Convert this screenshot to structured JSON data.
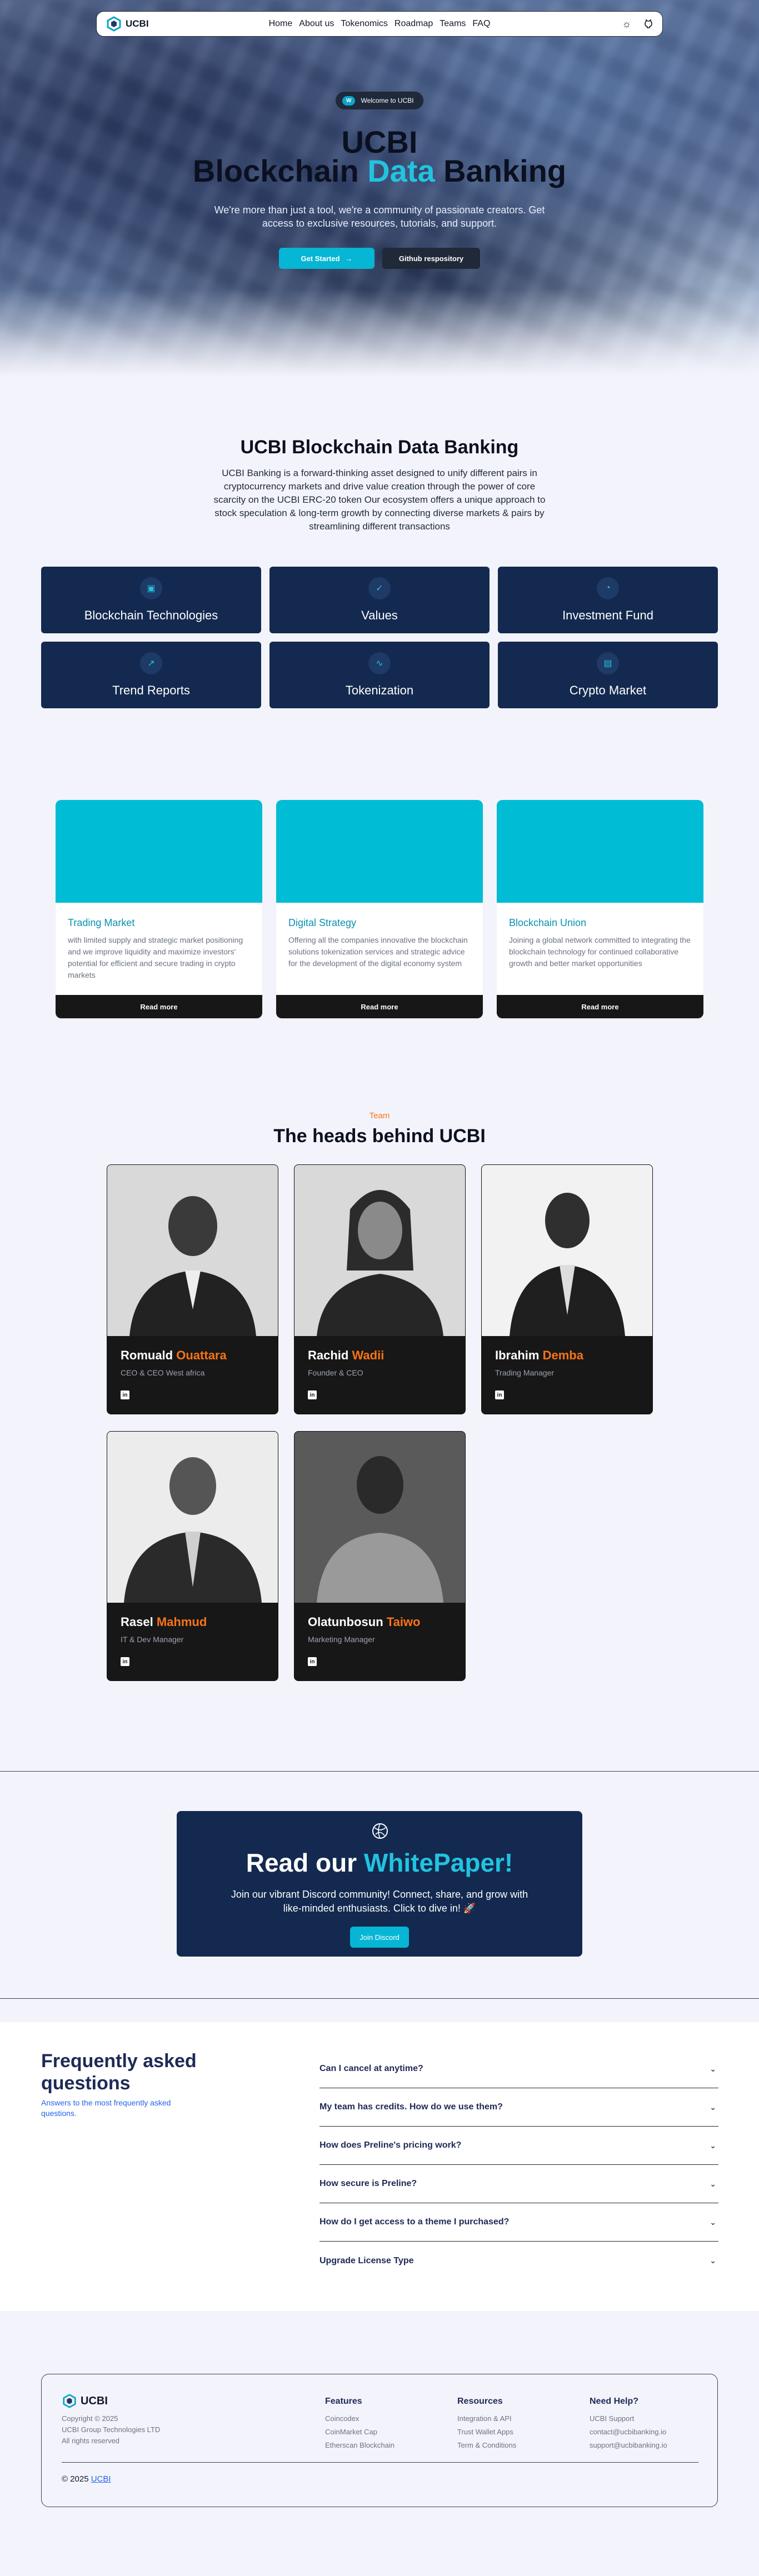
{
  "nav": {
    "brand": "UCBI",
    "links": [
      "Home",
      "About us",
      "Tokenomics",
      "Roadmap",
      "Teams",
      "FAQ"
    ]
  },
  "hero": {
    "badge_chip": "W",
    "badge_text": "Welcome to UCBI",
    "title_line1": "UCBI",
    "title_line2_a": "Blockchain",
    "title_line2_accent": "Data",
    "title_line2_b": "Banking",
    "subtitle": "We're more than just a tool, we're a community of passionate creators. Get access to exclusive resources, tutorials, and support.",
    "cta_primary": "Get Started",
    "cta_secondary": "Github respository"
  },
  "about": {
    "title": "UCBI Blockchain Data Banking",
    "text": "UCBI Banking is a forward-thinking asset designed to unify different pairs in cryptocurrency markets and drive value creation through the power of core scarcity on the UCBI ERC-20 token Our ecosystem offers a unique approach to stock speculation & long-term growth by connecting diverse markets & pairs by streamlining different transactions",
    "features": [
      {
        "label": "Blockchain Technologies",
        "icon": "building-icon"
      },
      {
        "label": "Values",
        "icon": "check-circle-icon"
      },
      {
        "label": "Investment Fund",
        "icon": "pie-chart-icon"
      },
      {
        "label": "Trend Reports",
        "icon": "trend-icon"
      },
      {
        "label": "Tokenization",
        "icon": "activity-icon"
      },
      {
        "label": "Crypto Market",
        "icon": "document-icon"
      }
    ]
  },
  "cards": [
    {
      "title": "Trading Market",
      "text": "with limited supply and strategic market positioning and we improve liquidity and maximize investors' potential for efficient and secure trading in crypto markets",
      "cta": "Read more"
    },
    {
      "title": "Digital Strategy",
      "text": "Offering all the companies innovative the blockchain solutions tokenization services and strategic advice for the development of the digital economy system",
      "cta": "Read more"
    },
    {
      "title": "Blockchain Union",
      "text": "Joining a global network committed to integrating the blockchain technology for continued collaborative growth and better market opportunities",
      "cta": "Read more"
    }
  ],
  "team": {
    "kicker": "Team",
    "title": "The heads behind UCBI",
    "members": [
      {
        "first": "Romuald",
        "last": "Ouattara",
        "role": "CEO & CEO West africa"
      },
      {
        "first": "Rachid",
        "last": "Wadii",
        "role": "Founder & CEO"
      },
      {
        "first": "Ibrahim",
        "last": "Demba",
        "role": "Trading Manager"
      },
      {
        "first": "Rasel",
        "last": "Mahmud",
        "role": "IT & Dev Manager"
      },
      {
        "first": "Olatunbosun",
        "last": "Taiwo",
        "role": "Marketing Manager"
      }
    ],
    "social_icon": "in"
  },
  "whitepaper": {
    "title_a": "Read our",
    "title_accent": "WhitePaper!",
    "text": "Join our vibrant Discord community! Connect, share, and grow with like-minded enthusiasts. Click to dive in! 🚀",
    "cta": "Join Discord"
  },
  "faq": {
    "title": "Frequently asked questions",
    "subtitle": "Answers to the most frequently asked questions.",
    "items": [
      "Can I cancel at anytime?",
      "My team has credits. How do we use them?",
      "How does Preline's pricing work?",
      "How secure is Preline?",
      "How do I get access to a theme I purchased?",
      "Upgrade License Type"
    ]
  },
  "footer": {
    "brand": "UCBI",
    "meta": [
      "Copyright © 2025",
      "UCBI Group Technologies LTD",
      "All rights reserved"
    ],
    "columns": [
      {
        "title": "Features",
        "links": [
          "Coincodex",
          "CoinMarket Cap",
          "Etherscan Blockchain"
        ]
      },
      {
        "title": "Resources",
        "links": [
          "Integration & API",
          "Trust Wallet Apps",
          "Term & Conditions"
        ]
      },
      {
        "title": "Need Help?",
        "links": [
          "UCBI Support",
          "contact@ucbibanking.io",
          "support@ucbibanking.io"
        ]
      }
    ],
    "copy_prefix": "© 2025",
    "copy_brand": "UCBI"
  },
  "colors": {
    "accent": "#22c3df",
    "navy": "#13294f",
    "orange": "#f97316",
    "cyan_card": "#00bcd4"
  }
}
